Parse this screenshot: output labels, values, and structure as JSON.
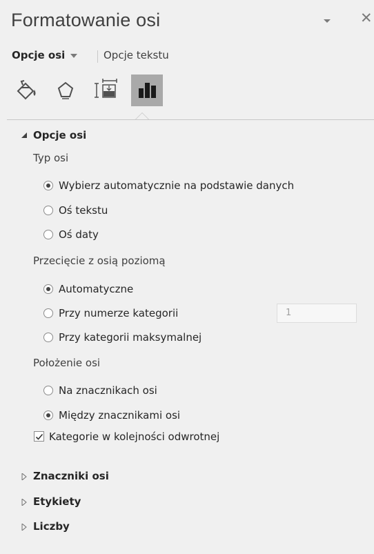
{
  "pane": {
    "title": "Formatowanie osi",
    "tabs": [
      {
        "label": "Opcje osi",
        "active": true
      },
      {
        "label": "Opcje tekstu",
        "active": false
      }
    ],
    "icons": [
      "fill-line-icon",
      "effects-pentagon-icon",
      "size-properties-icon",
      "axis-options-chart-icon"
    ],
    "selected_icon": "axis-options-chart-icon"
  },
  "axis_options": {
    "header": "Opcje osi",
    "axis_type": {
      "label": "Typ osi",
      "options": [
        {
          "label": "Wybierz automatycznie na podstawie danych",
          "selected": true
        },
        {
          "label": "Oś tekstu",
          "selected": false
        },
        {
          "label": "Oś daty",
          "selected": false
        }
      ]
    },
    "crossing": {
      "label": "Przecięcie z osią poziomą",
      "options": [
        {
          "label": "Automatyczne",
          "selected": true
        },
        {
          "label": "Przy numerze kategorii",
          "selected": false
        },
        {
          "label": "Przy kategorii maksymalnej",
          "selected": false
        }
      ],
      "category_number_value": "1"
    },
    "position": {
      "label": "Położenie osi",
      "options": [
        {
          "label": "Na znacznikach osi",
          "selected": false
        },
        {
          "label": "Między znacznikami osi",
          "selected": true
        }
      ]
    },
    "reverse_order": {
      "label": "Kategorie w kolejności odwrotnej",
      "checked": true
    }
  },
  "collapsed_sections": [
    "Znaczniki osi",
    "Etykiety",
    "Liczby"
  ],
  "colors": {
    "background": "#f0f0f0",
    "selected_icon_bg": "#a9a9a9",
    "text": "#262626",
    "muted": "#7a7a7a"
  }
}
